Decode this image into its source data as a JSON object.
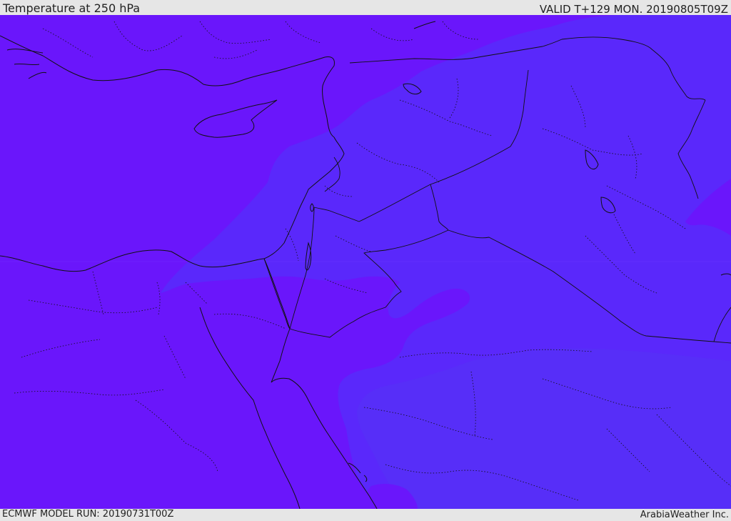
{
  "header": {
    "title": "Temperature at 250 hPa",
    "valid": "VALID T+129 MON. 20190805T09Z"
  },
  "footer": {
    "model_run": "ECMWF MODEL RUN: 20190731T00Z",
    "credit": "ArabiaWeather Inc."
  },
  "colors": {
    "field_cold": "#6a16fb",
    "field_warm": "#5a28fb",
    "field_warmer": "#5530f6",
    "outline": "#111111",
    "frame": "#e6e6e6"
  },
  "icons": {
    "map": "temperature-field-map"
  }
}
